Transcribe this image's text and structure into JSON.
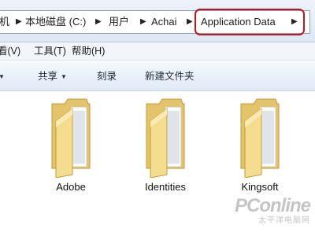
{
  "address_bar": {
    "crumbs": [
      "机",
      "本地磁盘 (C:)",
      "用户",
      "Achai",
      "Application Data"
    ],
    "highlight_color": "#c3141a"
  },
  "menu": {
    "items": [
      "看(V)",
      "工具(T)",
      "帮助(H)"
    ]
  },
  "toolbar": {
    "share_label": "共享",
    "burn_label": "刻录",
    "new_folder_label": "新建文件夹"
  },
  "folders": [
    {
      "name": "Adobe",
      "icon": "folder-icon"
    },
    {
      "name": "Identities",
      "icon": "folder-icon"
    },
    {
      "name": "Kingsoft",
      "icon": "folder-icon"
    }
  ],
  "watermark": {
    "main": "PConline",
    "sub": "太平洋电脑网"
  }
}
